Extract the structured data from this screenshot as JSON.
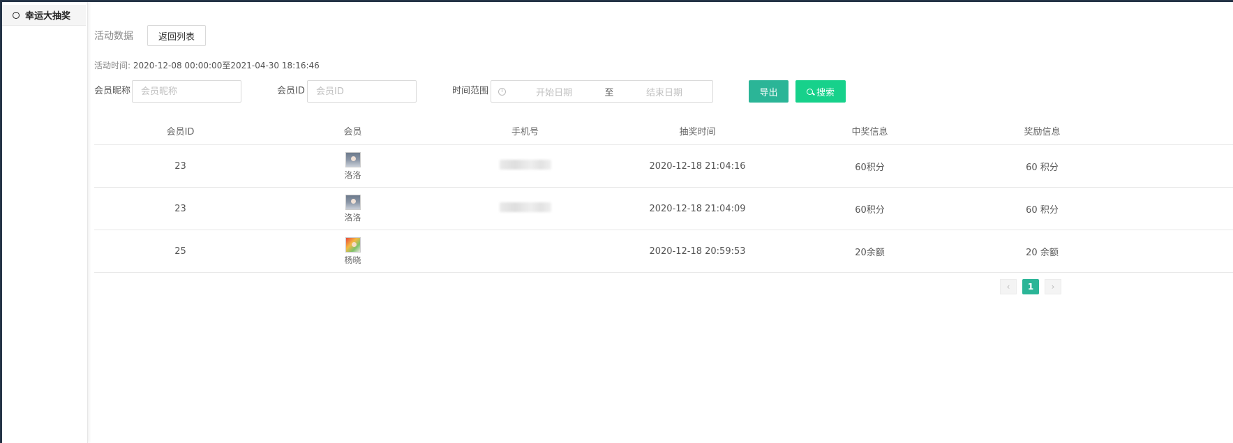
{
  "sidebar": {
    "items": [
      {
        "label": "幸运大抽奖",
        "icon": "ring-icon"
      }
    ]
  },
  "header": {
    "title": "活动数据",
    "back_button": "返回列表"
  },
  "activity": {
    "label": "活动时间:",
    "value": "2020-12-08 00:00:00至2021-04-30 18:16:46"
  },
  "filters": {
    "nickname_label": "会员昵称",
    "nickname_placeholder": "会员昵称",
    "id_label": "会员ID",
    "id_placeholder": "会员ID",
    "range_label": "时间范围",
    "start_placeholder": "开始日期",
    "separator": "至",
    "end_placeholder": "结束日期",
    "export_button": "导出",
    "search_button": "搜索"
  },
  "table": {
    "columns": [
      "会员ID",
      "会员",
      "手机号",
      "抽奖时间",
      "中奖信息",
      "奖励信息"
    ],
    "rows": [
      {
        "id": "23",
        "name": "洛洛",
        "avatar": "a1",
        "time": "2020-12-18 21:04:16",
        "prize": "60积分",
        "reward": "60 积分"
      },
      {
        "id": "23",
        "name": "洛洛",
        "avatar": "a1",
        "time": "2020-12-18 21:04:09",
        "prize": "60积分",
        "reward": "60 积分"
      },
      {
        "id": "25",
        "name": "杨晓",
        "avatar": "a2",
        "time": "2020-12-18 20:59:53",
        "prize": "20余额",
        "reward": "20 余额"
      }
    ]
  },
  "pagination": {
    "prev": "‹",
    "current": "1",
    "next": "›"
  },
  "colors": {
    "accent": "#2bb597",
    "search": "#17d18b"
  }
}
